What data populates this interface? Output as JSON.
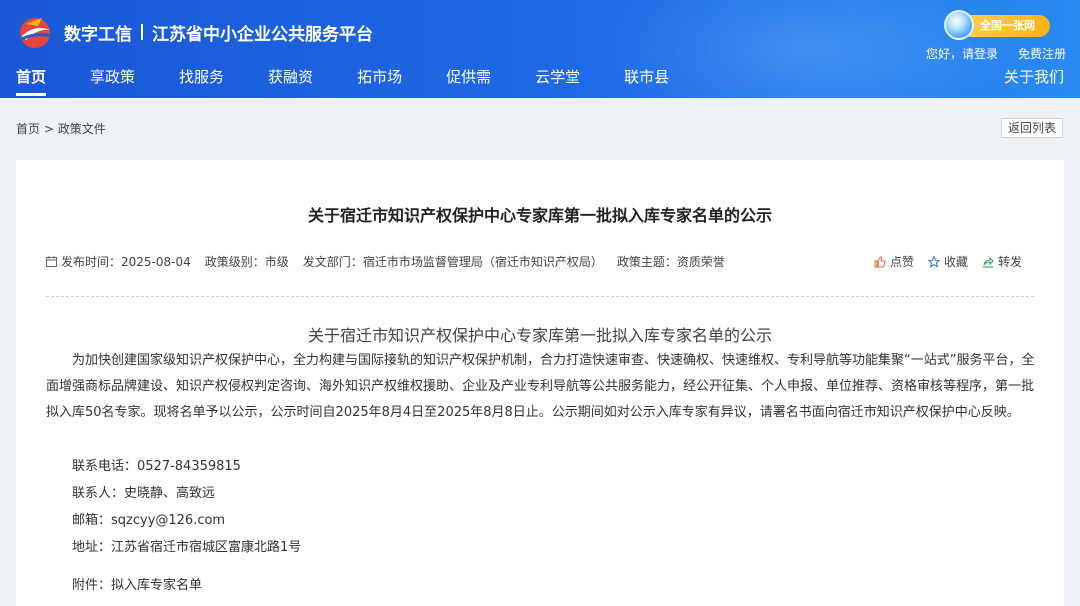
{
  "header": {
    "brand": "数字工信",
    "platform": "江苏省中小企业公共服务平台",
    "badge": "全国一张网",
    "login": "您好，请登录",
    "register": "免费注册",
    "about": "关于我们",
    "nav": [
      "首页",
      "享政策",
      "找服务",
      "获融资",
      "拓市场",
      "促供需",
      "云学堂",
      "联市县"
    ],
    "accent": "#1a57d6"
  },
  "breadcrumb": {
    "home": "首页",
    "separator": ">",
    "current": "政策文件",
    "back": "返回列表"
  },
  "doc": {
    "title": "关于宿迁市知识产权保护中心专家库第一批拟入库专家名单的公示",
    "meta": {
      "publish_label": "发布时间：",
      "publish_date": "2025-08-04",
      "level_label": "政策级别：",
      "level": "市级",
      "dept_label": "发文部门：",
      "dept": "宿迁市市场监督管理局（宿迁市知识产权局）",
      "topic_label": "政策主题：",
      "topic": "资质荣誉"
    },
    "actions": {
      "like": "点赞",
      "favorite": "收藏",
      "share": "转发"
    },
    "body_title": "关于宿迁市知识产权保护中心专家库第一批拟入库专家名单的公示",
    "paragraph": "为加快创建国家级知识产权保护中心，全力构建与国际接轨的知识产权保护机制，合力打造快速审查、快速确权、快速维权、专利导航等功能集聚“一站式”服务平台，全面增强商标品牌建设、知识产权侵权判定咨询、海外知识产权维权援助、企业及产业专利导航等公共服务能力，经公开征集、个人申报、单位推荐、资格审核等程序，第一批拟入库50名专家。现将名单予以公示，公示时间自2025年8月4日至2025年8月8日止。公示期间如对公示入库专家有异议，请署名书面向宿迁市知识产权保护中心反映。",
    "phone": "联系电话：0527-84359815",
    "contact": "联系人：史晓静、高致远",
    "email": "邮箱：sqzcyy@126.com",
    "address": "地址：江苏省宿迁市宿城区富康北路1号",
    "attachment": "附件：拟入库专家名单"
  }
}
